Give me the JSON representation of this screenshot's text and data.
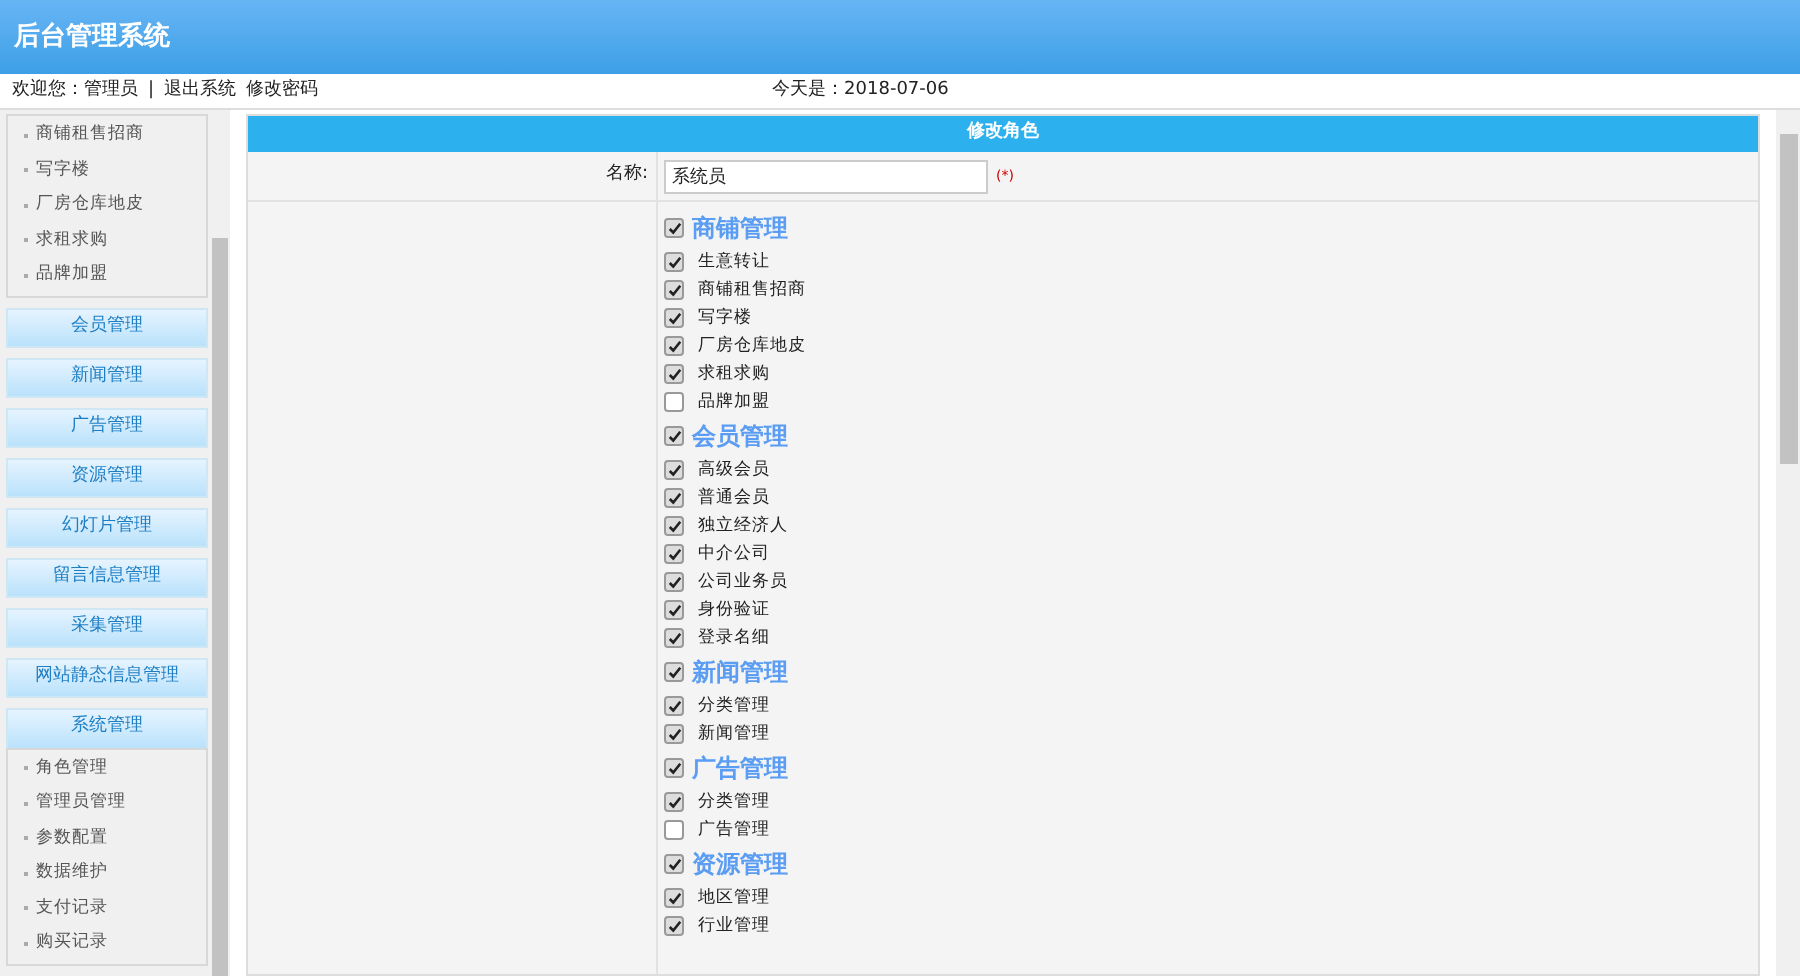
{
  "header": {
    "title": "后台管理系统"
  },
  "topbar": {
    "welcome": "欢迎您：管理员",
    "separator": "|",
    "logout": "退出系统",
    "change_password": "修改密码",
    "date": "今天是：2018-07-06"
  },
  "sidebar": {
    "sections": [
      {
        "expanded": true,
        "items": [
          "商铺租售招商",
          "写字楼",
          "厂房仓库地皮",
          "求租求购",
          "品牌加盟"
        ]
      },
      {
        "title": "会员管理",
        "expanded": false
      },
      {
        "title": "新闻管理",
        "expanded": false
      },
      {
        "title": "广告管理",
        "expanded": false
      },
      {
        "title": "资源管理",
        "expanded": false
      },
      {
        "title": "幻灯片管理",
        "expanded": false
      },
      {
        "title": "留言信息管理",
        "expanded": false
      },
      {
        "title": "采集管理",
        "expanded": false
      },
      {
        "title": "网站静态信息管理",
        "expanded": false
      },
      {
        "title": "系统管理",
        "expanded": true,
        "items": [
          "角色管理",
          "管理员管理",
          "参数配置",
          "数据维护",
          "支付记录",
          "购买记录"
        ]
      }
    ]
  },
  "form": {
    "title": "修改角色",
    "name_label": "名称:",
    "name_value": "系统员",
    "required_mark": "(*)",
    "groups": [
      {
        "label": "商铺管理",
        "checked": true,
        "children": [
          {
            "label": "生意转让",
            "checked": true
          },
          {
            "label": "商铺租售招商",
            "checked": true
          },
          {
            "label": "写字楼",
            "checked": true
          },
          {
            "label": "厂房仓库地皮",
            "checked": true
          },
          {
            "label": "求租求购",
            "checked": true
          },
          {
            "label": "品牌加盟",
            "checked": false
          }
        ]
      },
      {
        "label": "会员管理",
        "checked": true,
        "children": [
          {
            "label": "高级会员",
            "checked": true
          },
          {
            "label": "普通会员",
            "checked": true
          },
          {
            "label": "独立经济人",
            "checked": true
          },
          {
            "label": "中介公司",
            "checked": true
          },
          {
            "label": "公司业务员",
            "checked": true
          },
          {
            "label": "身份验证",
            "checked": true
          },
          {
            "label": "登录名细",
            "checked": true
          }
        ]
      },
      {
        "label": "新闻管理",
        "checked": true,
        "children": [
          {
            "label": "分类管理",
            "checked": true
          },
          {
            "label": "新闻管理",
            "checked": true
          }
        ]
      },
      {
        "label": "广告管理",
        "checked": true,
        "children": [
          {
            "label": "分类管理",
            "checked": true
          },
          {
            "label": "广告管理",
            "checked": false
          }
        ]
      },
      {
        "label": "资源管理",
        "checked": true,
        "children": [
          {
            "label": "地区管理",
            "checked": true
          },
          {
            "label": "行业管理",
            "checked": true
          }
        ]
      }
    ]
  }
}
